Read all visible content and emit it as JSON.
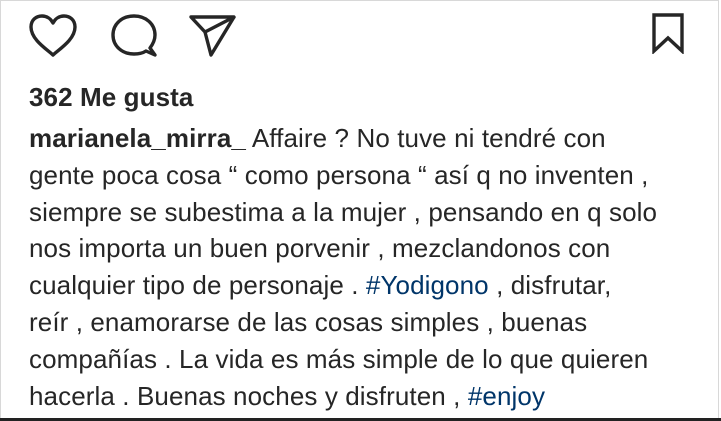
{
  "post": {
    "likes_text": "362 Me gusta",
    "username": "marianela_mirra_",
    "caption": {
      "line1": " Affaire ? No tuve ni tendré con",
      "line2": "gente poca cosa “ como persona “ así q no inventen ,",
      "line3": "siempre se subestima a la mujer , pensando en q solo",
      "line4": "nos importa un buen porvenir , mezclandonos con",
      "line5_a": "cualquier tipo de personaje . ",
      "hashtag1": "#Yodigono",
      "line5_b": " , disfrutar,",
      "line6": "reír , enamorarse de las cosas simples , buenas",
      "line7": "compañías . La vida es más simple de lo que quieren",
      "line8_a": "hacerla . Buenas noches y disfruten , ",
      "hashtag2": "#enjoy"
    }
  },
  "icons": {
    "like": "heart-outline-icon",
    "comment": "comment-bubble-icon",
    "share": "paper-plane-icon",
    "save": "bookmark-icon"
  },
  "colors": {
    "text": "#262626",
    "hashtag": "#003569",
    "background": "#ffffff"
  }
}
